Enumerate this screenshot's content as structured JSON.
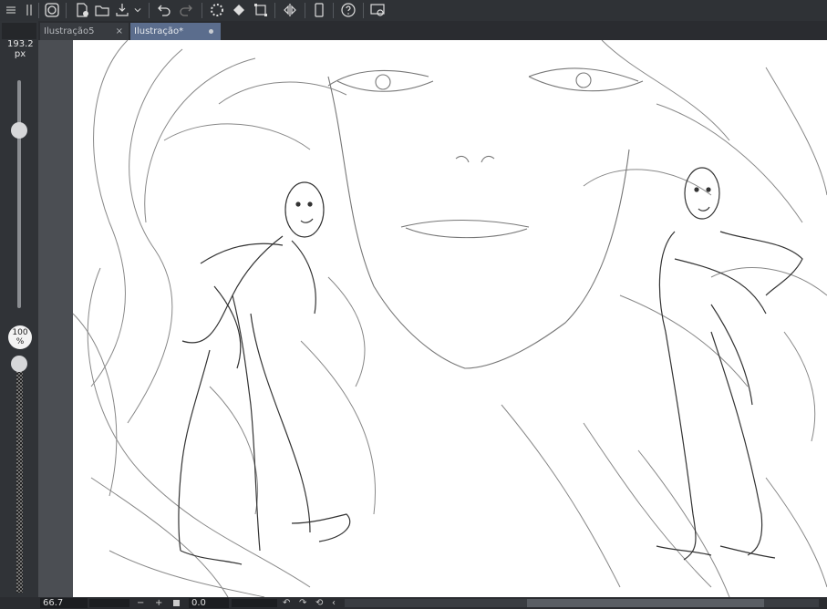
{
  "toolbar": {
    "icons": [
      "menu-icon",
      "pin-icon",
      "clip-studio-icon",
      "new-file-icon",
      "open-folder-icon",
      "save-icon",
      "dropdown-icon",
      "undo-icon",
      "redo-icon",
      "loading-icon",
      "fill-icon",
      "transform-icon",
      "flip-icon",
      "smartphone-icon",
      "help-icon",
      "screen-icon"
    ]
  },
  "tabs": [
    {
      "label": "Ilustração5",
      "close": "×"
    },
    {
      "label": "Ilustração*"
    }
  ],
  "left_panel": {
    "brush_size_value": "193.2",
    "brush_size_unit": "px",
    "opacity_value": "100",
    "opacity_unit": "%",
    "brush_size_fraction": 0.22,
    "opacity_fraction": 1.0
  },
  "status": {
    "zoom": "66.7",
    "minus": "−",
    "plus": "+",
    "rotation": "0.0"
  },
  "colors": {
    "canvas": "#ffffff",
    "accent_tab": "#5b6d8d"
  }
}
